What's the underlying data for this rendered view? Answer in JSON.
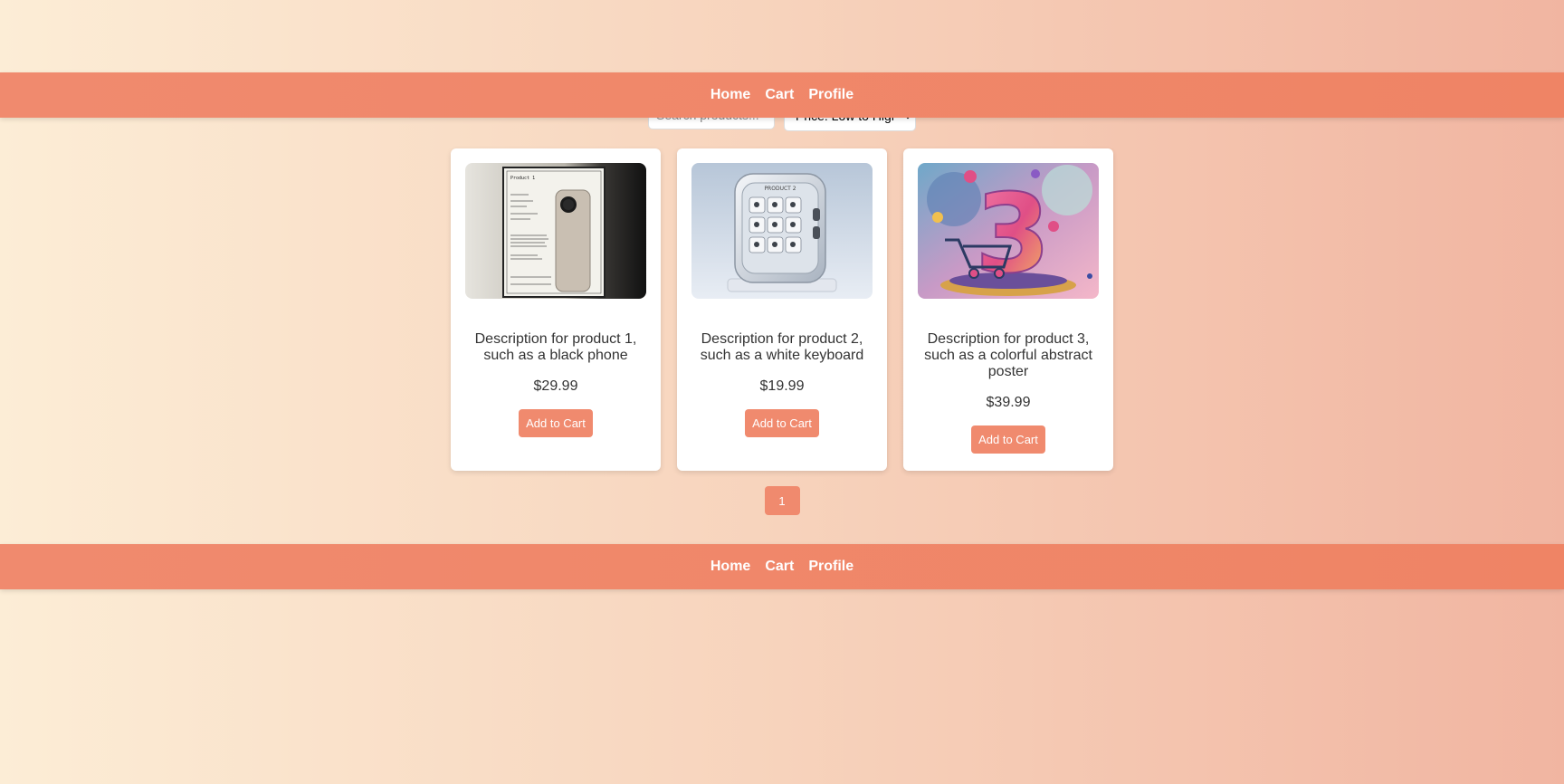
{
  "nav": {
    "items": [
      {
        "label": "Home"
      },
      {
        "label": "Cart"
      },
      {
        "label": "Profile"
      }
    ]
  },
  "controls": {
    "search_placeholder": "Search products...",
    "sort_selected": "Price: Low to High"
  },
  "products": [
    {
      "description": "Description for product 1, such as a black phone",
      "price": "$29.99",
      "button_label": "Add to Cart",
      "image_label": "Product 1"
    },
    {
      "description": "Description for product 2, such as a white keyboard",
      "price": "$19.99",
      "button_label": "Add to Cart",
      "image_label": "PRODUCT 2"
    },
    {
      "description": "Description for product 3, such as a colorful abstract poster",
      "price": "$39.99",
      "button_label": "Add to Cart",
      "image_label": "3"
    }
  ],
  "pagination": {
    "pages": [
      "1"
    ]
  },
  "footer": {
    "items": [
      {
        "label": "Home"
      },
      {
        "label": "Cart"
      },
      {
        "label": "Profile"
      }
    ]
  },
  "colors": {
    "accent": "#f08a6e",
    "gradient_start": "#fcedd6",
    "gradient_end": "#f1b5a1"
  }
}
